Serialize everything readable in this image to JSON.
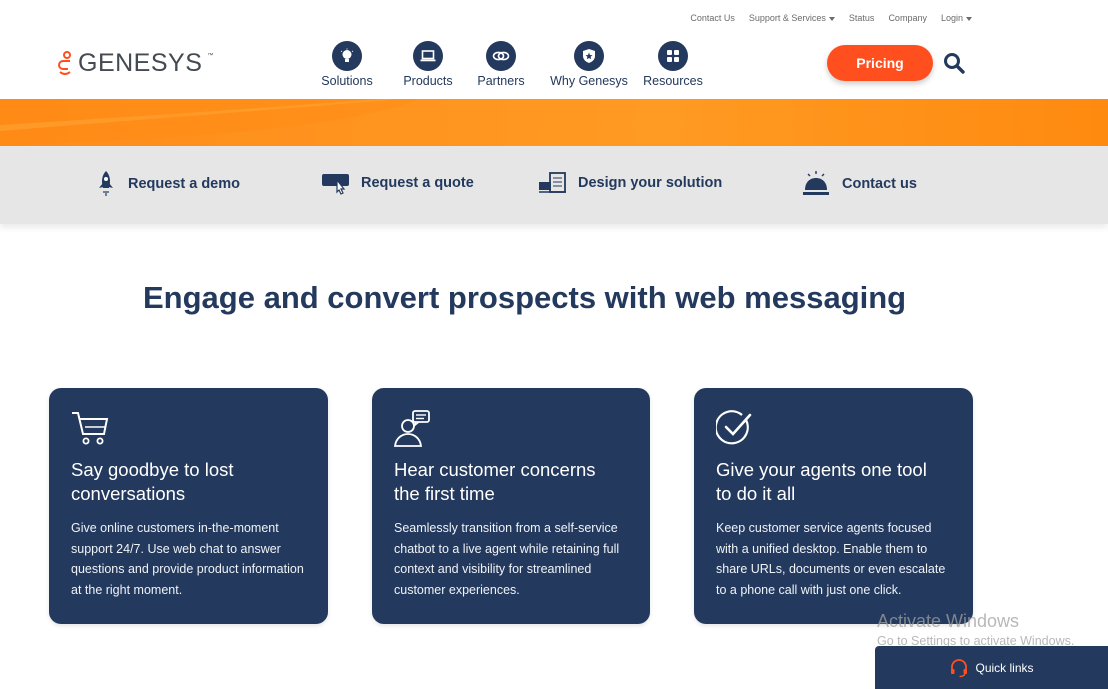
{
  "utility_nav": {
    "contact_us": "Contact Us",
    "support_services": "Support & Services",
    "status": "Status",
    "company": "Company",
    "login": "Login"
  },
  "logo": {
    "text": "GENESYS",
    "tm": "™"
  },
  "main_nav": {
    "items": [
      {
        "label": "Solutions",
        "icon": "lightbulb-icon"
      },
      {
        "label": "Products",
        "icon": "laptop-icon"
      },
      {
        "label": "Partners",
        "icon": "handshake-icon"
      },
      {
        "label": "Why Genesys",
        "icon": "shield-star-icon"
      },
      {
        "label": "Resources",
        "icon": "grid-icon"
      }
    ]
  },
  "header": {
    "pricing_label": "Pricing"
  },
  "actions": {
    "demo": "Request a demo",
    "quote": "Request a quote",
    "design": "Design your solution",
    "contact": "Contact us"
  },
  "headline": "Engage and convert prospects with web messaging",
  "cards": [
    {
      "icon": "shopping-cart-icon",
      "title_line1": "Say goodbye to lost",
      "title_line2": "conversations",
      "body": "Give online customers in-the-moment support 24/7. Use web chat to answer questions and provide product information at the right moment."
    },
    {
      "icon": "agent-chat-icon",
      "title_line1": "Hear customer concerns",
      "title_line2": "the first time",
      "body": "Seamlessly transition from a self-service chatbot to a live agent while retaining full context and visibility for streamlined customer experiences."
    },
    {
      "icon": "checkmark-circle-icon",
      "title_line1": "Give your agents one tool",
      "title_line2": "to do it all",
      "body": "Keep customer service agents focused with a unified desktop. Enable them to share URLs, documents or even escalate to a phone call with just one click."
    }
  ],
  "watermark": {
    "line1": "Activate Windows",
    "line2": "Go to Settings to activate Windows."
  },
  "quick_links": {
    "label": "Quick links"
  },
  "colors": {
    "navy": "#23395d",
    "orange": "#ff9a22",
    "pricing": "#ff4f1f",
    "action_bar": "#e6e6e6"
  }
}
